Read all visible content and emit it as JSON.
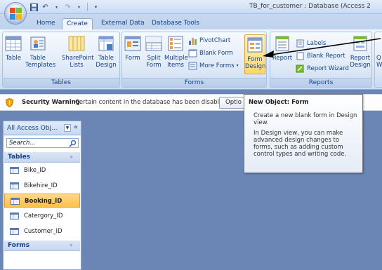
{
  "window": {
    "title": "TB_for_customer : Database (Access 2"
  },
  "tabs": [
    {
      "label": "Home",
      "active": false
    },
    {
      "label": "Create",
      "active": true
    },
    {
      "label": "External Data",
      "active": false
    },
    {
      "label": "Database Tools",
      "active": false
    }
  ],
  "ribbon": {
    "tables": {
      "label": "Tables",
      "table": "Table",
      "templates": "Table Templates",
      "sharepoint": "SharePoint Lists",
      "design": "Table Design"
    },
    "forms": {
      "label": "Forms",
      "form": "Form",
      "split": "Split Form",
      "multiple": "Multiple Items",
      "pivotchart": "PivotChart",
      "blank_form": "Blank Form",
      "more_forms": "More Forms",
      "form_design": "Form Design"
    },
    "reports": {
      "label": "Reports",
      "report": "Report",
      "labels": "Labels",
      "blank_report": "Blank Report",
      "report_wizard": "Report Wizard",
      "report_design": "Report Design"
    },
    "other": {
      "q": "Q",
      "w": "W"
    }
  },
  "security": {
    "title": "Security Warning",
    "text": "Certain content in the database has been disabled",
    "options": "Optio"
  },
  "tooltip": {
    "title": "New Object: Form",
    "p1": "Create a new blank form in Design view.",
    "p2": "In Design view, you can make advanced design changes to forms, such as adding custom control types and writing code."
  },
  "nav": {
    "title": "All Access Obj...",
    "search_placeholder": "Search...",
    "sections": [
      {
        "label": "Tables",
        "chevron": "»"
      },
      {
        "label": "Forms",
        "chevron": "»"
      }
    ],
    "items": [
      {
        "label": "Bike_ID"
      },
      {
        "label": "Bikehire_ID"
      },
      {
        "label": "Booking_ID"
      },
      {
        "label": "Catergory_ID"
      },
      {
        "label": "Customer_ID"
      }
    ]
  }
}
